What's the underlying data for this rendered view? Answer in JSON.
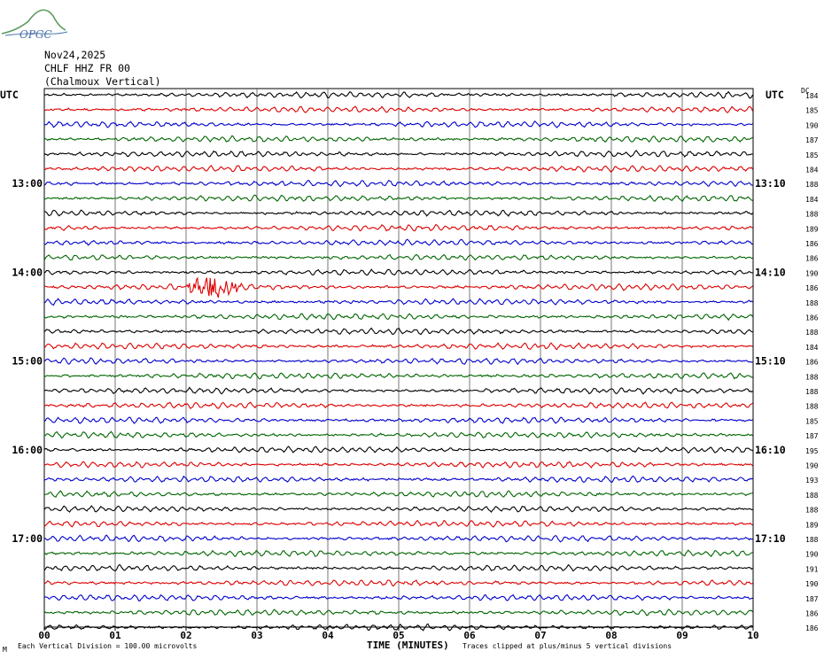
{
  "logo": {
    "text": "OPGC"
  },
  "header": {
    "date": "Nov24,2025",
    "station": "CHLF HHZ FR 00",
    "site": "(Chalmoux Vertical)"
  },
  "left_unit": "UTC",
  "right_unit": "UTC",
  "dc_label": "DC",
  "footer": {
    "scale_note": "Each Vertical Division =  100.00 microvolts",
    "clip_note": "Traces clipped at plus/minus 5 vertical divisions",
    "corner_mark": "M"
  },
  "chart_data": {
    "type": "line",
    "title": "CHLF HHZ FR 00 (Chalmoux Vertical)",
    "xlabel": "TIME (MINUTES)",
    "ylabel": "UTC",
    "xlim": [
      0,
      10
    ],
    "x_ticks": [
      "00",
      "01",
      "02",
      "03",
      "04",
      "05",
      "06",
      "07",
      "08",
      "09",
      "10"
    ],
    "left_time_labels": [
      {
        "row": 6,
        "text": "13:00"
      },
      {
        "row": 12,
        "text": "14:00"
      },
      {
        "row": 18,
        "text": "15:00"
      },
      {
        "row": 24,
        "text": "16:00"
      },
      {
        "row": 30,
        "text": "17:00"
      }
    ],
    "right_time_labels": [
      {
        "row": 6,
        "text": "13:10"
      },
      {
        "row": 12,
        "text": "14:10"
      },
      {
        "row": 18,
        "text": "15:10"
      },
      {
        "row": 24,
        "text": "16:10"
      },
      {
        "row": 30,
        "text": "17:10"
      }
    ],
    "trace_colors": [
      "#000000",
      "#dd0000",
      "#0000cc",
      "#006600"
    ],
    "dc_offsets": [
      184,
      185,
      190,
      187,
      185,
      184,
      188,
      184,
      188,
      189,
      186,
      186,
      190,
      186,
      188,
      186,
      188,
      184,
      186,
      188,
      188,
      188,
      185,
      187,
      195,
      190,
      193,
      188,
      188,
      189,
      188,
      190,
      191,
      190,
      187,
      186,
      186
    ],
    "events": [
      {
        "row": 13,
        "start_min": 2.0,
        "end_min": 2.8,
        "label": ""
      }
    ],
    "grid": true
  }
}
